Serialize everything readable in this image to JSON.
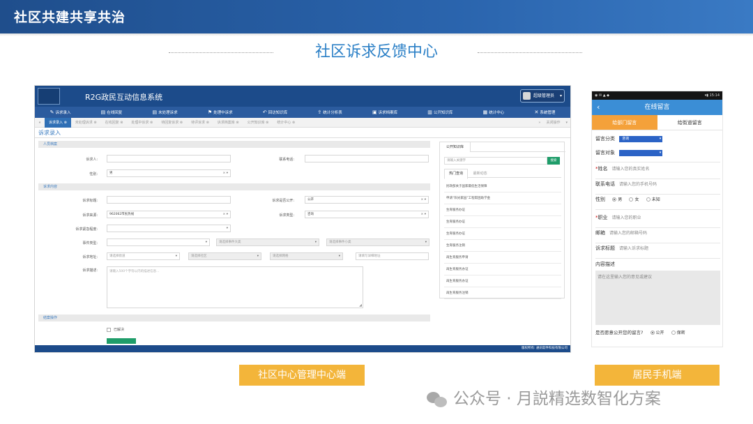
{
  "slide": {
    "top_title": "社区共建共享共治",
    "heading": "社区诉求反馈中心",
    "caption_left": "社区中心管理中心端",
    "caption_right": "居民手机端",
    "watermark": "公众号 · 月説精选数智化方案"
  },
  "desktop": {
    "system_title": "R2G政民互动信息系统",
    "user_label": "超级管理员",
    "nav": [
      {
        "label": "诉求录入",
        "icon": "pencil-icon"
      },
      {
        "label": "在线回复",
        "icon": "list-icon"
      },
      {
        "label": "未处理诉求",
        "icon": "list-icon"
      },
      {
        "label": "处理中诉求",
        "icon": "flag-icon"
      },
      {
        "label": "回访知识库",
        "icon": "reply-icon"
      },
      {
        "label": "统计分析表",
        "icon": "upload-icon"
      },
      {
        "label": "诉求档案库",
        "icon": "file-icon"
      },
      {
        "label": "公开知识库",
        "icon": "book-icon"
      },
      {
        "label": "统计中心",
        "icon": "chart-icon"
      },
      {
        "label": "系统管理",
        "icon": "wrench-icon"
      }
    ],
    "tabs": [
      "诉求录入",
      "未处理诉求",
      "在线回复",
      "处理中诉求",
      "待回复诉求",
      "待评诉求",
      "诉求档案库",
      "公开知识库",
      "统计中心"
    ],
    "tabs_right": "关闭操作",
    "section_title": "诉求录入",
    "bars": [
      "人员档案",
      "诉求内容",
      "结案操作"
    ],
    "labels": {
      "petitioner": "诉求人:",
      "phone": "联系电话:",
      "gender": "性别:",
      "subject": "诉求标题:",
      "is_public": "诉求是否公开:",
      "source": "诉求来源:",
      "type": "诉求类型:",
      "urgency": "诉求紧急程度:",
      "event_type": "事件类型:",
      "address": "诉求地址:",
      "description": "诉求描述:",
      "closed": "已解决"
    },
    "values": {
      "gender": "男",
      "is_public": "公开",
      "source": "962062市民热线",
      "type": "咨询"
    },
    "placeholders": {
      "event_sub1": "请选择事件大类",
      "event_sub2": "请选择事件小类",
      "street": "请选择街道",
      "community": "请选择社区",
      "grid": "请选择网格",
      "detail_addr": "请填写详细地址",
      "description": "请输入500个字符以内的描述信息..."
    },
    "panel": {
      "tab": "公开知识库",
      "search_placeholder": "请输入关键字",
      "search_button": "搜索",
      "subtabs": [
        "热门查询",
        "最新动态"
      ],
      "items": [
        "民政部关于国家最低生活保障",
        "申请“阳光家园”工程帮困助学金",
        "生育服务办证",
        "生育服务办证",
        "生育服务办证",
        "生育服务注销",
        "再生育服务申请",
        "再生育服务办证",
        "再生育服务办证",
        "再生育服务注销"
      ]
    },
    "footer": "版权所有: 通讯软件科技有限公司"
  },
  "mobile": {
    "status_left": "◉ ✉ ▲ ◆",
    "status_right": "▾▮ 15:14",
    "title": "在线留言",
    "tabs": [
      "给部门留言",
      "给街道留言"
    ],
    "category_label": "留言分类",
    "category_value": "咨询",
    "target_label": "留言对象",
    "name_label": "姓名",
    "name_placeholder": "请输入您的真实姓名",
    "phone_label": "联系电话",
    "phone_placeholder": "请输入您的手机号码",
    "gender_label": "性别",
    "gender_options": [
      "男",
      "女",
      "未知"
    ],
    "job_label": "职业",
    "job_placeholder": "请输入您的职业",
    "email_label": "邮箱",
    "email_placeholder": "请输入您的邮箱号码",
    "subject_label": "诉求标题",
    "subject_placeholder": "请输入诉求标题",
    "content_label": "内容描述",
    "content_placeholder": "请在这里输入您的意见或建议",
    "public_label": "是否愿意公开您的留言?",
    "public_options": [
      "公开",
      "保密"
    ]
  }
}
